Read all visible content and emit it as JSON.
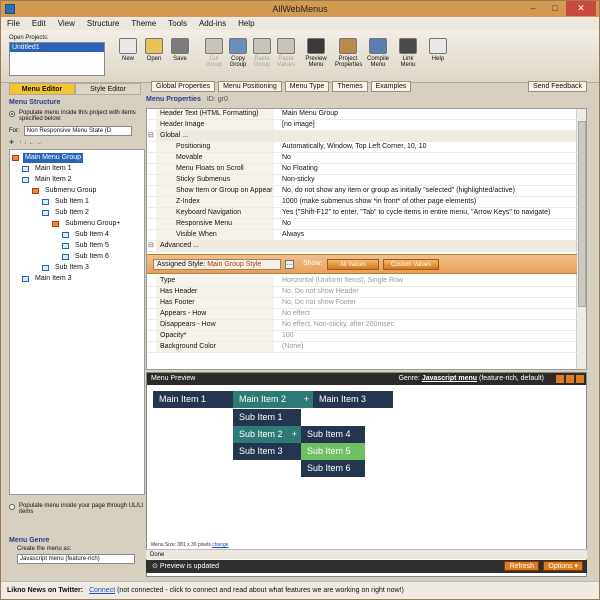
{
  "window": {
    "title": "AllWebMenus"
  },
  "menubar": [
    "File",
    "Edit",
    "View",
    "Structure",
    "Theme",
    "Tools",
    "Add-ins",
    "Help"
  ],
  "toolbar": {
    "open_projects_label": "Open Projects:",
    "open_projects": [
      "Untitled1"
    ],
    "buttons": [
      {
        "label": "New",
        "icon": "new-icon",
        "disabled": false
      },
      {
        "label": "Open",
        "icon": "open-folder-icon",
        "disabled": false
      },
      {
        "label": "Save",
        "icon": "save-icon",
        "disabled": false
      },
      {
        "label": "Cut Group",
        "icon": "cut-icon",
        "disabled": true
      },
      {
        "label": "Copy Group",
        "icon": "copy-icon",
        "disabled": false
      },
      {
        "label": "Paste Group",
        "icon": "paste-icon",
        "disabled": true
      },
      {
        "label": "Paste Values",
        "icon": "paste-values-icon",
        "disabled": true
      },
      {
        "label": "Preview Menu",
        "icon": "preview-icon",
        "disabled": false
      },
      {
        "label": "Project Properties",
        "icon": "properties-icon",
        "disabled": false
      },
      {
        "label": "Compile Menu",
        "icon": "compile-icon",
        "disabled": false
      },
      {
        "label": "Link Menu",
        "icon": "link-icon",
        "disabled": false
      },
      {
        "label": "Help",
        "icon": "help-icon",
        "disabled": false
      }
    ]
  },
  "left_tabs": {
    "menu_editor": "Menu Editor",
    "style_editor": "Style Editor"
  },
  "prop_buttons": [
    "Global Properties",
    "Menu Positioning",
    "Menu Type",
    "Themes",
    "Examples"
  ],
  "send_feedback": "Send Feedback",
  "menu_structure": {
    "title": "Menu Structure",
    "populate_label": "Populate menu inside this project with items specified below:",
    "for_label": "For:",
    "for_value": "Non Responsive Menu State (D",
    "tree": [
      {
        "label": "Main Menu Group",
        "type": "group",
        "depth": 0,
        "selected": true
      },
      {
        "label": "Main Item 1",
        "type": "item",
        "depth": 1
      },
      {
        "label": "Main Item 2",
        "type": "item",
        "depth": 1
      },
      {
        "label": "Submenu Group",
        "type": "group",
        "depth": 2
      },
      {
        "label": "Sub Item 1",
        "type": "item",
        "depth": 3
      },
      {
        "label": "Sub Item 2",
        "type": "item",
        "depth": 3
      },
      {
        "label": "Submenu Group+",
        "type": "group",
        "depth": 4
      },
      {
        "label": "Sub Item 4",
        "type": "item",
        "depth": 5
      },
      {
        "label": "Sub Item 5",
        "type": "item",
        "depth": 5
      },
      {
        "label": "Sub Item 6",
        "type": "item",
        "depth": 5
      },
      {
        "label": "Sub Item 3",
        "type": "item",
        "depth": 3
      },
      {
        "label": "Main Item 3",
        "type": "item",
        "depth": 1
      }
    ],
    "populate_ul_label": "Populate menu inside your page through UL/LI items"
  },
  "menu_genre": {
    "title": "Menu Genre",
    "create_label": "Create the menu as:",
    "value": "Javascript menu (feature-rich)"
  },
  "properties": {
    "title": "Menu Properties",
    "id": "ID: gr0",
    "rows": [
      {
        "k": "Header Text (HTML Formatting)",
        "v": "Main Menu Group",
        "section": false,
        "indent": false,
        "dim": false
      },
      {
        "k": "Header Image",
        "v": "[no image]",
        "section": false,
        "indent": false,
        "dim": false
      },
      {
        "k": "Global ...",
        "v": "",
        "section": true,
        "indent": false,
        "dim": false
      },
      {
        "k": "Positioning",
        "v": "Automatically, Window, Top Left Corner, 10, 10",
        "section": false,
        "indent": true,
        "dim": false
      },
      {
        "k": "Movable",
        "v": "No",
        "section": false,
        "indent": true,
        "dim": false
      },
      {
        "k": "Menu Floats on Scroll",
        "v": "No Floating",
        "section": false,
        "indent": true,
        "dim": false
      },
      {
        "k": "Sticky Submenus",
        "v": "Non-sticky",
        "section": false,
        "indent": true,
        "dim": false
      },
      {
        "k": "Show Item or Group on Appear",
        "v": "No, do not show any item or group as initially \"selected\" (highlighted/active)",
        "section": false,
        "indent": true,
        "dim": false
      },
      {
        "k": "Z-Index",
        "v": "1000 (make submenus show *in front* of other page elements)",
        "section": false,
        "indent": true,
        "dim": false
      },
      {
        "k": "Keyboard Navigation",
        "v": "Yes (\"Shift-F12\" to enter, \"Tab\" to cycle items in entire menu, \"Arrow Keys\" to navigate)",
        "section": false,
        "indent": true,
        "dim": false
      },
      {
        "k": "Responsive Menu",
        "v": "No",
        "section": false,
        "indent": true,
        "dim": false
      },
      {
        "k": "Visible When",
        "v": "Always",
        "section": false,
        "indent": true,
        "dim": false
      },
      {
        "k": "Advanced ...",
        "v": "",
        "section": true,
        "indent": false,
        "dim": false
      }
    ],
    "assigned": {
      "label": "Assigned Style:",
      "value": "Main Group Style",
      "show_label": "Show:",
      "all_values": "All Values",
      "custom_values": "Custom Values"
    },
    "style_rows": [
      {
        "k": "Type",
        "v": "Horizontal (Uniform Items), Single Row",
        "dim": true
      },
      {
        "k": "Has Header",
        "v": "No, Do not show Header",
        "dim": true
      },
      {
        "k": "Has Footer",
        "v": "No, Do not show Footer",
        "dim": true
      },
      {
        "k": "Appears - How",
        "v": "No effect",
        "dim": true
      },
      {
        "k": "Disappears - How",
        "v": "No effect, Non-sticky, after 200msec",
        "dim": true
      },
      {
        "k": "Opacity*",
        "v": "100",
        "dim": true
      },
      {
        "k": "Background Color",
        "v": "(None)",
        "dim": true
      }
    ]
  },
  "preview": {
    "title": "Menu Preview",
    "genre_label": "Genre:",
    "genre_value": "Javascript menu",
    "genre_note": "(feature-rich, default)",
    "main_items": [
      "Main Item 1",
      "Main Item 2",
      "Main Item 3"
    ],
    "main_item2_plus": "+",
    "sub_items": [
      "Sub Item 1",
      "Sub Item 2",
      "Sub Item 3"
    ],
    "sub_item2_plus": "+",
    "subsub_items": [
      "Sub Item 4",
      "Sub Item 5",
      "Sub Item 6"
    ],
    "menu_size_label": "Menu Size: 381 x 30 pixels",
    "change_link": "change",
    "colors": {
      "main": "#24364f",
      "active": "#2e7a74",
      "hover": "#6fbf63"
    }
  },
  "done_text": "Done",
  "updated_text": "Preview is updated",
  "refresh_label": "Refresh",
  "options_label": "Options",
  "status": {
    "label": "Likno News on Twitter:",
    "link": "Connect",
    "note": "(not connected - click to connect and read about what features we are working on right now!)"
  }
}
